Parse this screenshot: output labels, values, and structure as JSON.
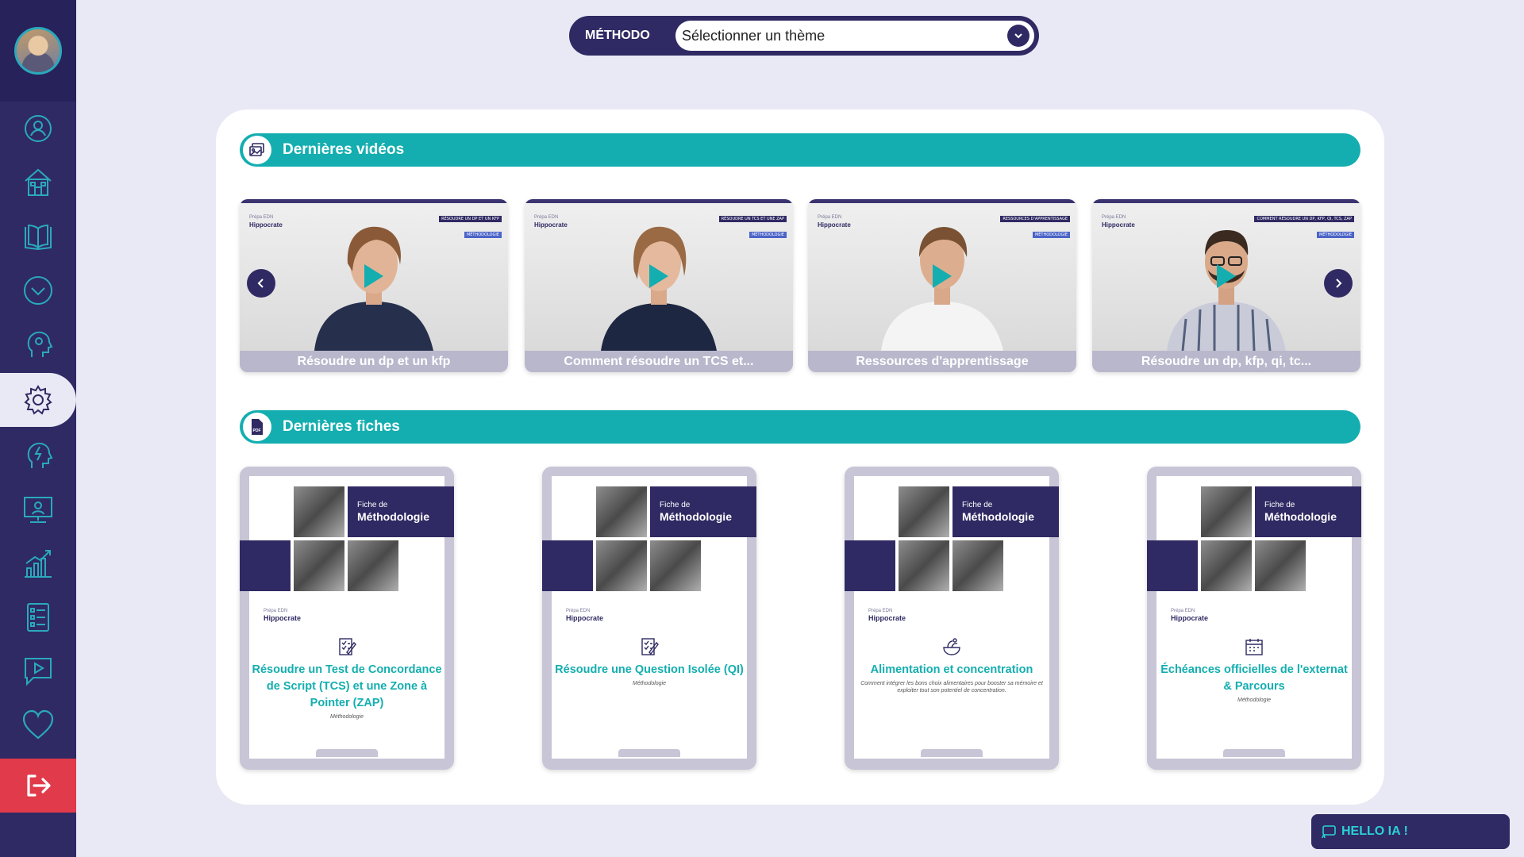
{
  "header": {
    "category_label": "MÉTHODO",
    "theme_select": {
      "value": "Sélectionner un thème"
    }
  },
  "sidebar": {
    "items": [
      {
        "icon": "user-gear-icon"
      },
      {
        "icon": "home-icon"
      },
      {
        "icon": "book-icon"
      },
      {
        "icon": "chevron-circle-icon"
      },
      {
        "icon": "head-gear-icon"
      },
      {
        "icon": "settings-icon",
        "active": true
      },
      {
        "icon": "head-lightning-icon"
      },
      {
        "icon": "presentation-icon"
      },
      {
        "icon": "stats-icon"
      },
      {
        "icon": "list-icon"
      },
      {
        "icon": "video-chat-icon"
      },
      {
        "icon": "heart-icon"
      },
      {
        "icon": "logout-icon"
      }
    ]
  },
  "videos": {
    "title": "Dernières vidéos",
    "items": [
      {
        "caption": "Résoudre un dp et un kfp",
        "brand": "Hippocrate",
        "brand_small": "Prépa EDN",
        "tag1": "RÉSOUDRE UN DP ET UN KFP",
        "tag2": "MÉTHODOLOGIE"
      },
      {
        "caption": "Comment résoudre un TCS et...",
        "brand": "Hippocrate",
        "brand_small": "Prépa EDN",
        "tag1": "RÉSOUDRE UN TCS ET UNE ZAP",
        "tag2": "MÉTHODOLOGIE"
      },
      {
        "caption": "Ressources d'apprentissage",
        "brand": "Hippocrate",
        "brand_small": "Prépa EDN",
        "tag1": "RESSOURCES D'APPRENTISSAGE",
        "tag2": "MÉTHODOLOGIE"
      },
      {
        "caption": "Résoudre un dp, kfp, qi, tc...",
        "brand": "Hippocrate",
        "brand_small": "Prépa EDN",
        "tag1": "COMMENT RÉSOUDRE UN DP, KFP, QI, TCS, ZAP",
        "tag2": "MÉTHODOLOGIE"
      }
    ]
  },
  "fiches": {
    "title": "Dernières fiches",
    "items": [
      {
        "header_small": "Fiche de",
        "header_big": "Méthodologie",
        "brand": "Hippocrate",
        "brand_small": "Prépa EDN",
        "title": "Résoudre un Test de Concordance de Script (TCS) et une Zone à Pointer (ZAP)",
        "subtitle": "Méthodologie"
      },
      {
        "header_small": "Fiche de",
        "header_big": "Méthodologie",
        "brand": "Hippocrate",
        "brand_small": "Prépa EDN",
        "title": "Résoudre une Question Isolée (QI)",
        "subtitle": "Méthodologie"
      },
      {
        "header_small": "Fiche de",
        "header_big": "Méthodologie",
        "brand": "Hippocrate",
        "brand_small": "Prépa EDN",
        "title": "Alimentation et concentration",
        "subtitle": "Comment intégrer les bons choix alimentaires pour booster sa mémoire et exploiter tout son potentiel de concentration."
      },
      {
        "header_small": "Fiche de",
        "header_big": "Méthodologie",
        "brand": "Hippocrate",
        "brand_small": "Prépa EDN",
        "title": "Échéances officielles de l'externat & Parcours",
        "subtitle": "Méthodologie"
      }
    ]
  },
  "assistant": {
    "label": "HELLO IA !"
  },
  "colors": {
    "primary": "#2f2a63",
    "accent": "#14aeb0",
    "logout": "#e03a4b",
    "background": "#e9e9f5"
  }
}
